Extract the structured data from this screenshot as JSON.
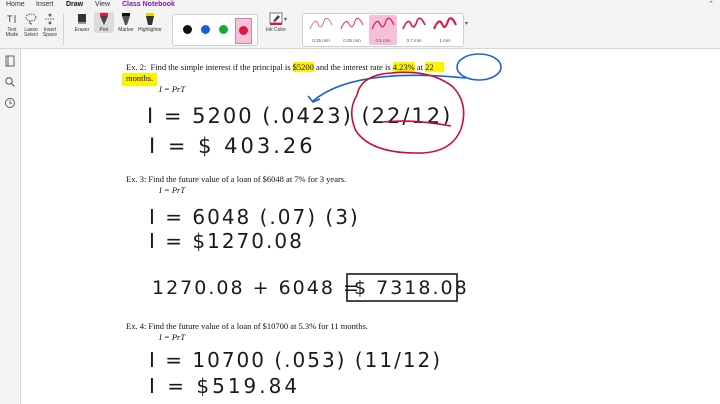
{
  "menu": {
    "tabs": [
      "Home",
      "Insert",
      "Draw",
      "View",
      "Class Notebook"
    ],
    "active": "Draw"
  },
  "ribbon": {
    "tools": {
      "text_mode": "Text Mode",
      "lasso_select": "Lasso Select",
      "insert_space": "Insert Space",
      "eraser": "Eraser",
      "pen": "Pen",
      "marker": "Marker",
      "highlighter": "Highlighter",
      "ink_color": "Ink Color"
    },
    "colors": [
      "#111111",
      "#1a5fd6",
      "#1aa83a",
      "#e0163d"
    ],
    "stroke_sizes": [
      "0.25 mm",
      "0.35 mm",
      "0.5 mm",
      "0.7 mm",
      "1 mm"
    ],
    "selected_stroke": "0.5 mm"
  },
  "page": {
    "ex2": {
      "prompt_prefix": "Ex. 2:  Find the simple interest if the principal is ",
      "principal": "$5200",
      "prompt_mid": " and the interest rate is ",
      "rate": "4.23%",
      "prompt_at": " at ",
      "time_num": "22",
      "time_unit": "months.",
      "formula": "I = PrT",
      "hw_line1": "I = 5200 (.0423) (22/12)",
      "hw_line2": "I = $ 403.26"
    },
    "ex3": {
      "prompt": "Ex. 3:  Find the future value of a loan of $6048 at 7% for 3 years.",
      "formula": "I = PrT",
      "hw_line1": "I = 6048 (.07) (3)",
      "hw_line2": "I = $1270.08",
      "hw_sum": "1270.08 + 6048 =",
      "hw_answer": "$ 7318.08"
    },
    "ex4": {
      "prompt": "Ex. 4:  Find the future value of a loan of $10700 at 5.3% for 11 months.",
      "formula": "I = PrT",
      "hw_line1": "I = 10700 (.053) (11/12)",
      "hw_line2": "I = $519.84"
    }
  }
}
